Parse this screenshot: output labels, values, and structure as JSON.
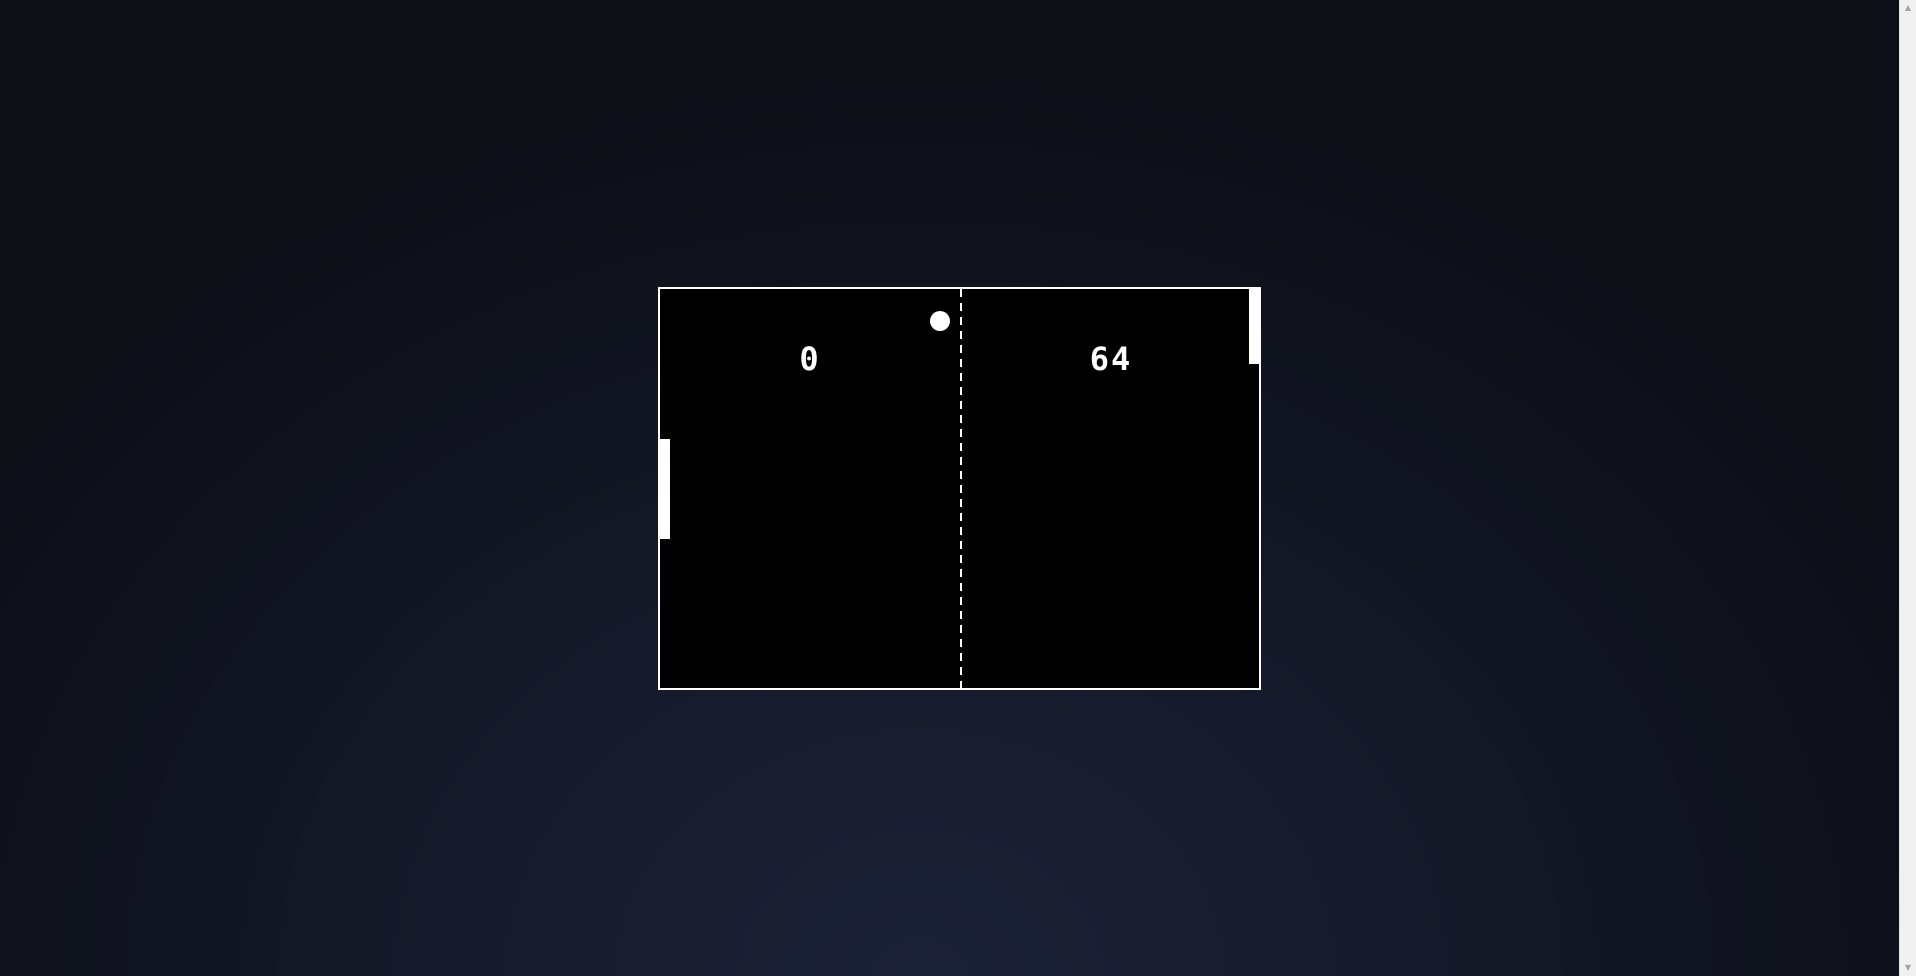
{
  "game": {
    "score": {
      "left": "0",
      "right": "64"
    },
    "paddles": {
      "left_label": "player-paddle",
      "right_label": "opponent-paddle"
    }
  },
  "colors": {
    "court": "#000000",
    "foreground": "#ffffff",
    "background": "#151a2a"
  }
}
